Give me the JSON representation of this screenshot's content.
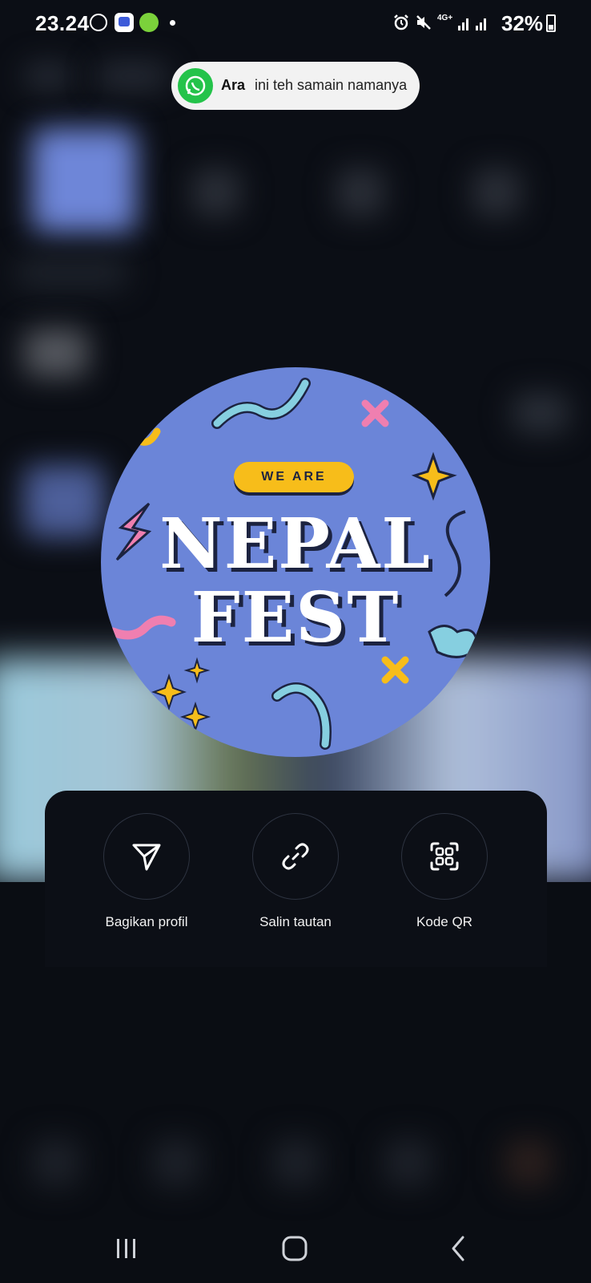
{
  "status_bar": {
    "time": "23.24",
    "network": "4G+",
    "battery": "32%"
  },
  "notification": {
    "app_icon": "whatsapp-icon",
    "sender": "Ara",
    "message": "ini teh samain namanya"
  },
  "profile_image": {
    "badge_text": "WE ARE",
    "title_line1": "NEPAL",
    "title_line2": "FEST",
    "colors": {
      "background": "#6b85d8",
      "badge": "#f7bd1a",
      "outline": "#1c2340"
    }
  },
  "share_sheet": {
    "actions": [
      {
        "label": "Bagikan profil",
        "icon": "send-icon"
      },
      {
        "label": "Salin tautan",
        "icon": "link-icon"
      },
      {
        "label": "Kode QR",
        "icon": "qr-code-icon"
      }
    ]
  },
  "nav_bar": {
    "items": [
      "recent-apps-icon",
      "home-icon",
      "back-icon"
    ]
  }
}
